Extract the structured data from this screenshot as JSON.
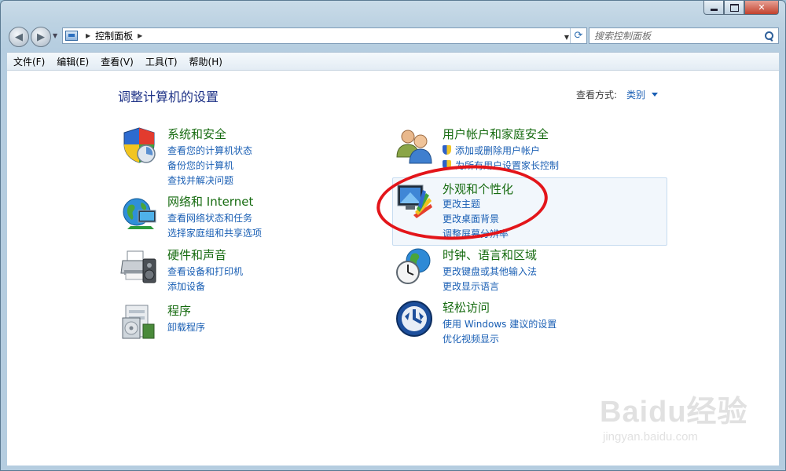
{
  "window": {
    "caption": {
      "minimize": "",
      "maximize": "",
      "close": "✕"
    }
  },
  "nav": {
    "back_icon": "◀",
    "forward_icon": "▶",
    "breadcrumb": "控制面板",
    "search_placeholder": "搜索控制面板"
  },
  "menu": [
    {
      "label": "文件(F)"
    },
    {
      "label": "编辑(E)"
    },
    {
      "label": "查看(V)"
    },
    {
      "label": "工具(T)"
    },
    {
      "label": "帮助(H)"
    }
  ],
  "content": {
    "title": "调整计算机的设置",
    "view_by_label": "查看方式:",
    "view_by_value": "类别",
    "categories": [
      {
        "title": "系统和安全",
        "icon": "system-security-shield-icon",
        "links": [
          "查看您的计算机状态",
          "备份您的计算机",
          "查找并解决问题"
        ]
      },
      {
        "title": "网络和 Internet",
        "icon": "network-globe-icon",
        "links": [
          "查看网络状态和任务",
          "选择家庭组和共享选项"
        ]
      },
      {
        "title": "硬件和声音",
        "icon": "printer-speaker-icon",
        "links": [
          "查看设备和打印机",
          "添加设备"
        ]
      },
      {
        "title": "程序",
        "icon": "programs-box-icon",
        "links": [
          "卸载程序"
        ]
      },
      {
        "title": "用户帐户和家庭安全",
        "icon": "users-icon",
        "links": [
          "添加或删除用户帐户",
          "为所有用户设置家长控制"
        ]
      },
      {
        "title": "外观和个性化",
        "icon": "appearance-monitor-icon",
        "links": [
          "更改主题",
          "更改桌面背景",
          "调整屏幕分辨率"
        ]
      },
      {
        "title": "时钟、语言和区域",
        "icon": "clock-globe-icon",
        "links": [
          "更改键盘或其他输入法",
          "更改显示语言"
        ]
      },
      {
        "title": "轻松访问",
        "icon": "ease-of-access-icon",
        "links": [
          "使用 Windows 建议的设置",
          "优化视频显示"
        ]
      }
    ]
  },
  "watermark": {
    "logo": "Baidu经验",
    "url": "jingyan.baidu.com"
  },
  "colors": {
    "category_title": "#166b10",
    "link": "#1a5fb4",
    "page_title": "#1e3287",
    "annotation_ellipse": "#e3151a"
  }
}
